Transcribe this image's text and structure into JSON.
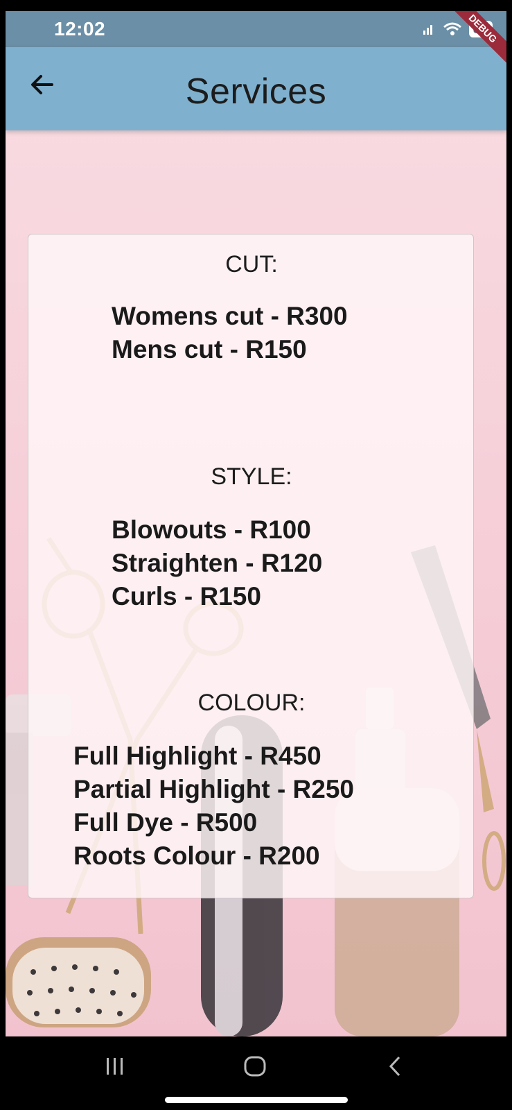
{
  "status_bar": {
    "time": "12:02",
    "battery": "89",
    "icons": [
      "cat-icon",
      "gear-icon",
      "alarm-icon",
      "mute-icon",
      "wifi-calling-icon",
      "signal-icon",
      "wifi-icon"
    ]
  },
  "app_bar": {
    "title": "Services",
    "back_icon": "arrow-left-icon",
    "background": "#7fb1cf",
    "debug_banner": "DEBUG"
  },
  "sections": [
    {
      "heading": "CUT:",
      "items": [
        "Womens cut - R300",
        "Mens cut - R150"
      ]
    },
    {
      "heading": "STYLE:",
      "items": [
        "Blowouts - R100",
        "Straighten - R120",
        "Curls - R150"
      ]
    },
    {
      "heading": "COLOUR:",
      "items": [
        "Full Highlight - R450",
        "Partial Highlight - R250",
        "Full Dye - R500",
        "Roots Colour - R200"
      ]
    }
  ],
  "nav_bar": {
    "icons": [
      "recents-icon",
      "home-icon",
      "back-icon"
    ]
  }
}
